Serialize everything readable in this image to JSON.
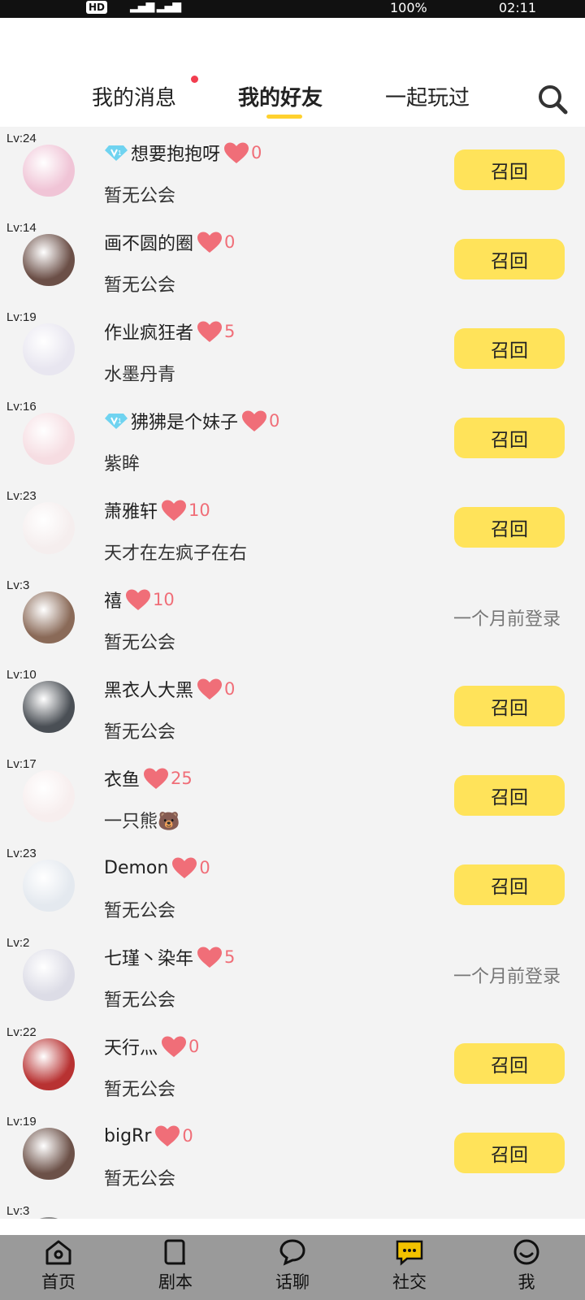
{
  "status_bar": {
    "hd": "HD",
    "time": "02:11",
    "battery": "100%"
  },
  "tabs": {
    "messages": "我的消息",
    "friends": "我的好友",
    "played": "一起玩过"
  },
  "friends": [
    {
      "level": "Lv:24",
      "vip": true,
      "name": "想要抱抱呀",
      "likes": "0",
      "guild": "暂无公会",
      "action": "召回",
      "avatar_color": "#f0c4d6"
    },
    {
      "level": "Lv:14",
      "vip": false,
      "name": "画不圆的圈",
      "likes": "0",
      "guild": "暂无公会",
      "action": "召回",
      "avatar_color": "#6b4f47"
    },
    {
      "level": "Lv:19",
      "vip": false,
      "name": "作业疯狂者",
      "likes": "5",
      "guild": "水墨丹青",
      "action": "召回",
      "avatar_color": "#e8e6f0"
    },
    {
      "level": "Lv:16",
      "vip": true,
      "name": "狒狒是个妹子",
      "likes": "0",
      "guild": "紫眸",
      "action": "召回",
      "avatar_color": "#f6dde2"
    },
    {
      "level": "Lv:23",
      "vip": false,
      "name": "萧雅轩",
      "likes": "10",
      "guild": "天才在左疯子在右",
      "action": "召回",
      "avatar_color": "#f5eeee"
    },
    {
      "level": "Lv:3",
      "vip": false,
      "name": "禧",
      "likes": "10",
      "guild": "暂无公会",
      "last_login": "一个月前登录",
      "avatar_color": "#8a6a58"
    },
    {
      "level": "Lv:10",
      "vip": false,
      "name": "黑衣人大黑",
      "likes": "0",
      "guild": "暂无公会",
      "action": "召回",
      "avatar_color": "#4a4f55"
    },
    {
      "level": "Lv:17",
      "vip": false,
      "name": "衣鱼",
      "likes": "25",
      "guild": "一只熊🐻",
      "action": "召回",
      "avatar_color": "#f7eeee"
    },
    {
      "level": "Lv:23",
      "vip": false,
      "name": "Demon",
      "likes": "0",
      "guild": "暂无公会",
      "action": "召回",
      "avatar_color": "#e4e9ef"
    },
    {
      "level": "Lv:2",
      "vip": false,
      "name": "七瑾丶染年",
      "likes": "5",
      "guild": "暂无公会",
      "last_login": "一个月前登录",
      "avatar_color": "#dcdce6"
    },
    {
      "level": "Lv:22",
      "vip": false,
      "name": "天行灬",
      "likes": "0",
      "guild": "暂无公会",
      "action": "召回",
      "avatar_color": "#b83232"
    },
    {
      "level": "Lv:19",
      "vip": false,
      "name": "bigRr",
      "likes": "0",
      "guild": "暂无公会",
      "action": "召回",
      "avatar_color": "#6c5148"
    },
    {
      "level": "Lv:3",
      "vip": false,
      "name": "",
      "likes": "",
      "guild": "",
      "action": "",
      "avatar_color": "#555"
    }
  ],
  "bottom_nav": [
    {
      "label": "首页",
      "icon": "home-icon"
    },
    {
      "label": "剧本",
      "icon": "script-book-icon"
    },
    {
      "label": "话聊",
      "icon": "chat-bubble-icon"
    },
    {
      "label": "社交",
      "icon": "social-message-icon"
    },
    {
      "label": "我",
      "icon": "profile-icon"
    }
  ],
  "colors": {
    "accent_yellow": "#ffe35a",
    "tab_underline": "#ffd12e",
    "heart": "#f06e78",
    "badge_dot": "#f23d4f"
  }
}
